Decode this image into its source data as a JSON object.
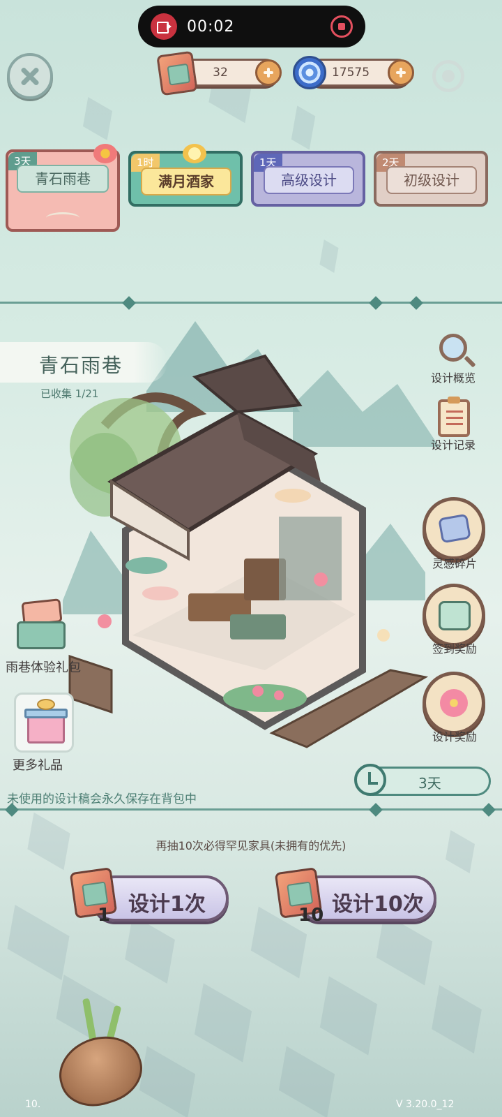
{
  "recorder": {
    "time": "00:02"
  },
  "topbar": {
    "scroll_count": "32",
    "swirl_count": "17575"
  },
  "tabs": [
    {
      "days": "3天",
      "label": "青石雨巷"
    },
    {
      "days": "1时",
      "label": "满月酒家"
    },
    {
      "days": "1天",
      "label": "高级设计"
    },
    {
      "days": "2天",
      "label": "初级设计"
    }
  ],
  "banner": {
    "title": "青石雨巷",
    "collected": "已收集 1/21"
  },
  "side_menu": {
    "overview": "设计概览",
    "records": "设计记录",
    "fragments": "灵感碎片",
    "checkin": "签到奖励",
    "reward": "设计奖励"
  },
  "gifts": {
    "pack": "雨巷体验礼包",
    "more": "更多礼品"
  },
  "timer": {
    "remaining": "3天"
  },
  "notes": {
    "save": "未使用的设计稿会永久保存在背包中",
    "hint": "再抽10次必得罕见家具(未拥有的优先)"
  },
  "draw": {
    "single_count": "1",
    "single_label": "设计1次",
    "ten_count": "10",
    "ten_label": "设计10次"
  },
  "footer": {
    "left": "10.",
    "version": "V 3.20.0_12"
  },
  "colors": {
    "accent_teal": "#4e8a80",
    "tab_red": "#f5bbb3",
    "tab_green": "#6fc0aa",
    "tab_purple": "#b9b6dc",
    "tab_tan": "#e1cfc6"
  }
}
